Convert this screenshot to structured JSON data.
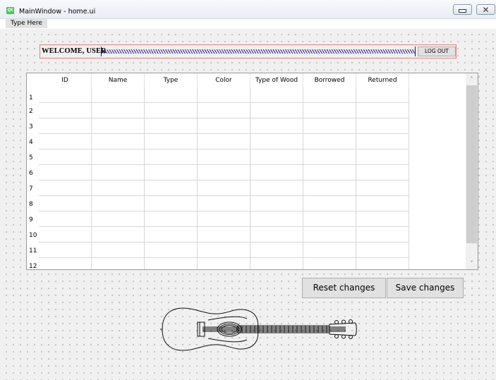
{
  "window": {
    "title": "MainWindow - home.ui",
    "app_icon": "qt-icon",
    "icon_text": "Qt"
  },
  "menubar": {
    "items": [
      {
        "label": "Type Here"
      }
    ]
  },
  "welcome": {
    "label": "WELCOME, USER",
    "logout_label": "LOG OUT"
  },
  "table": {
    "columns": [
      "ID",
      "Name",
      "Type",
      "Color",
      "Type of Wood",
      "Borrowed",
      "Returned"
    ],
    "row_numbers": [
      "1",
      "2",
      "3",
      "4",
      "5",
      "6",
      "7",
      "8",
      "9",
      "10",
      "11",
      "12"
    ],
    "scroll_up": "˄",
    "scroll_down": "˅"
  },
  "actions": {
    "reset_label": "Reset changes",
    "save_label": "Save changes"
  },
  "image": {
    "icon": "guitar-icon"
  }
}
